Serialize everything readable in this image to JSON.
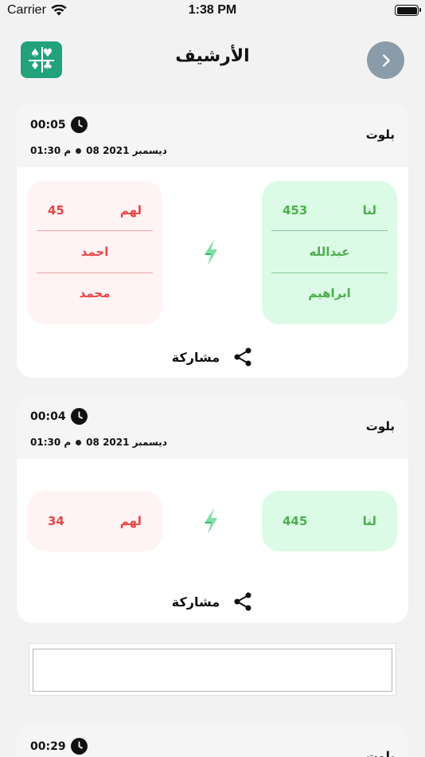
{
  "status_bar": {
    "carrier": "Carrier",
    "time": "1:38 PM"
  },
  "header": {
    "title": "الأرشيف",
    "icon": "cards-suits-icon",
    "forward_icon": "chevron-right-icon"
  },
  "colors": {
    "accent": "#21a27a",
    "us": "#4cae4e",
    "them": "#e84545",
    "us_bg": "#dcfbe6",
    "them_bg": "#fff3f3",
    "nav_button": "#8a9ba9"
  },
  "games": [
    {
      "game": "بلوت",
      "duration": "00:05",
      "date": "08 ديسمبر 2021",
      "time": "01:30 م",
      "us": {
        "label": "لنا",
        "score": "453",
        "players": [
          "عبدالله",
          "ابراهيم"
        ]
      },
      "them": {
        "label": "لهم",
        "score": "45",
        "players": [
          "احمد",
          "محمد"
        ]
      },
      "share_label": "مشاركة"
    },
    {
      "game": "بلوت",
      "duration": "00:04",
      "date": "08 ديسمبر 2021",
      "time": "01:30 م",
      "us": {
        "label": "لنا",
        "score": "445"
      },
      "them": {
        "label": "لهم",
        "score": "34"
      },
      "share_label": "مشاركة"
    },
    {
      "game": "بلوت",
      "duration": "00:29"
    }
  ]
}
